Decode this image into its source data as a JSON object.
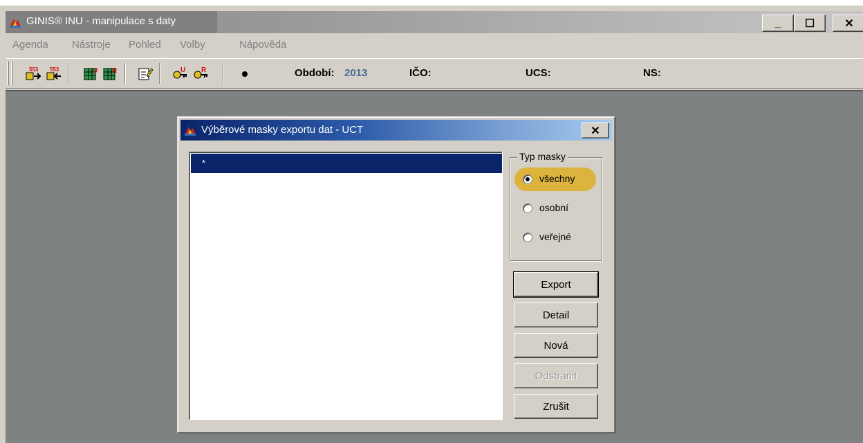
{
  "app": {
    "title": "GINIS® INU - manipulace s daty",
    "window_controls": {
      "minimize": "_",
      "maximize": "☐",
      "close": "✕"
    }
  },
  "menu": {
    "items": [
      "Agenda",
      "Nástroje",
      "Pohled",
      "Volby",
      "Nápověda"
    ]
  },
  "toolbar": {
    "icons": [
      "export-553-icon",
      "import-553-icon",
      "table-u-icon",
      "table-r-icon",
      "edit-form-icon",
      "key-u-icon",
      "key-r-icon",
      "dot-icon"
    ],
    "obdobi_label": "Období:",
    "obdobi_value": "2013",
    "ico_label": "IČO:",
    "ucs_label": "UCS:",
    "ns_label": "NS:"
  },
  "dialog": {
    "title": "Výběrové masky exportu dat - UCT",
    "close": "✕",
    "list_items": [
      "*"
    ],
    "mask_type": {
      "legend": "Typ masky",
      "options": [
        "všechny",
        "osobní",
        "veřejné"
      ],
      "selected": "všechny"
    },
    "buttons": {
      "export": "Export",
      "detail": "Detail",
      "nova": "Nová",
      "odstranit": "Odstranit",
      "zrusit": "Zrušit"
    }
  },
  "colors": {
    "selection": "#0a246a",
    "highlight": "#dbb33d",
    "workspace": "#7f8282"
  }
}
